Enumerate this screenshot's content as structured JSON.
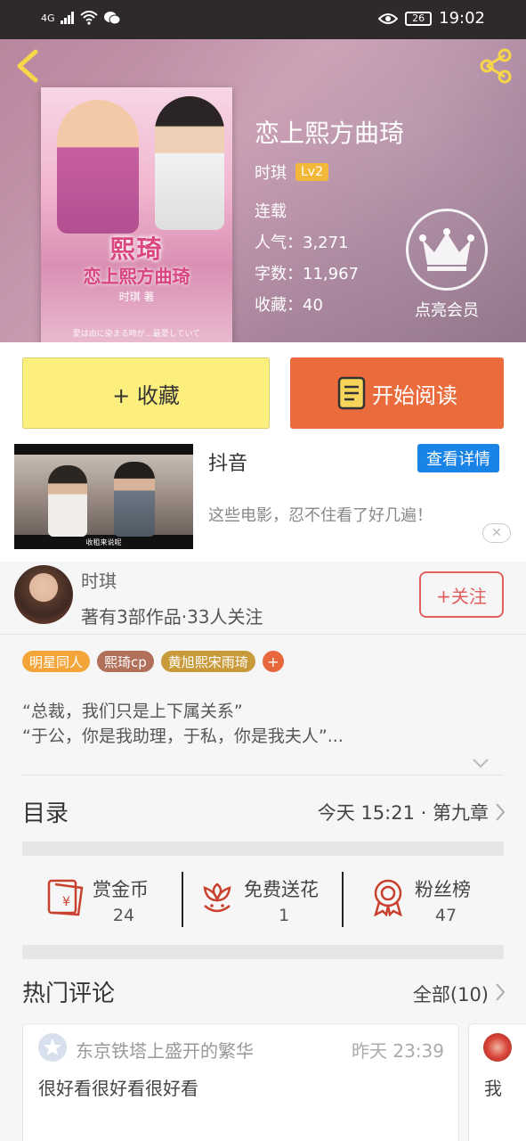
{
  "status_bar": {
    "network": "4G",
    "battery": "26",
    "time": "19:02"
  },
  "header": {
    "book_title": "恋上熙方曲琦",
    "author": "时琪",
    "level": "Lv2",
    "status": "连载",
    "popularity": "人气：3,271",
    "word_count": "字数：11,967",
    "favorites": "收藏：40",
    "vip_label": "点亮会员",
    "cover": {
      "title": "熙琦",
      "subtitle": "恋上熙方曲琦",
      "author": "时琪 著",
      "footnote": "愛は由に染まる時が…最愛していて"
    },
    "colors": {
      "level_badge": "#f3b83a"
    }
  },
  "actions": {
    "favorite_label": "+ 收藏",
    "read_label": "开始阅读",
    "colors": {
      "favorite_bg": "#fcef7e",
      "read_bg": "#ea6b3c"
    }
  },
  "ad": {
    "title": "抖音",
    "detail_label": "查看详情",
    "description": "这些电影，忍不住看了好几遍！",
    "video_caption": "收租来说呢",
    "close_icon": "close-icon",
    "colors": {
      "detail_bg": "#1a83e6"
    }
  },
  "author_card": {
    "name": "时琪",
    "stats": "著有3部作品·33人关注",
    "follow_label": "+关注"
  },
  "tags": [
    {
      "label": "明星同人",
      "color": "#f3a53a"
    },
    {
      "label": "熙琦cp",
      "color": "#b0705a"
    },
    {
      "label": "黄旭熙宋雨琦",
      "color": "#c99a3a"
    },
    {
      "label": "+",
      "color": "#e8673c"
    }
  ],
  "intro": {
    "line1": "“总裁，我们只是上下属关系”",
    "line2": "“于公，你是我助理，于私，你是我夫人”..."
  },
  "toc": {
    "title": "目录",
    "latest": "今天 15:21 · 第九章"
  },
  "stats": [
    {
      "label": "赏金币",
      "value": "24",
      "icon": "red-envelope-icon"
    },
    {
      "label": "免费送花",
      "value": "1",
      "icon": "flower-icon"
    },
    {
      "label": "粉丝榜",
      "value": "47",
      "icon": "medal-icon"
    }
  ],
  "comments": {
    "title": "热门评论",
    "all_label": "全部(10)",
    "items": [
      {
        "user": "东京铁塔上盛开的繁华",
        "time": "昨天 23:39",
        "text": "很好看很好看很好看"
      },
      {
        "text": "我"
      }
    ]
  }
}
